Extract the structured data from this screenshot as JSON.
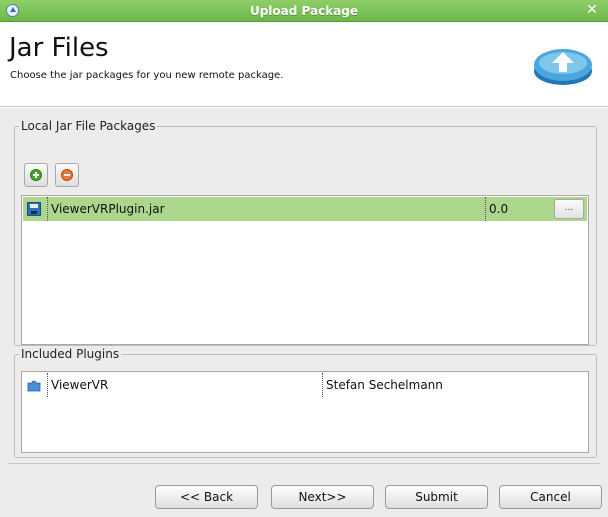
{
  "window": {
    "title": "Upload Package"
  },
  "header": {
    "title": "Jar Files",
    "subtitle": "Choose the jar packages for you new remote package."
  },
  "local_jars": {
    "legend": "Local Jar File Packages",
    "rows": [
      {
        "name": "ViewerVRPlugin.jar",
        "version": "0.0",
        "action_label": "..."
      }
    ]
  },
  "included_plugins": {
    "legend": "Included Plugins",
    "rows": [
      {
        "name": "ViewerVR",
        "author": "Stefan Sechelmann"
      }
    ]
  },
  "footer": {
    "back_label": "<< Back",
    "next_label": "Next>>",
    "submit_label": "Submit",
    "cancel_label": "Cancel"
  },
  "colors": {
    "title_bar": "#7cc35a",
    "selected_row": "#abd68b",
    "panel_bg": "#ececec"
  }
}
